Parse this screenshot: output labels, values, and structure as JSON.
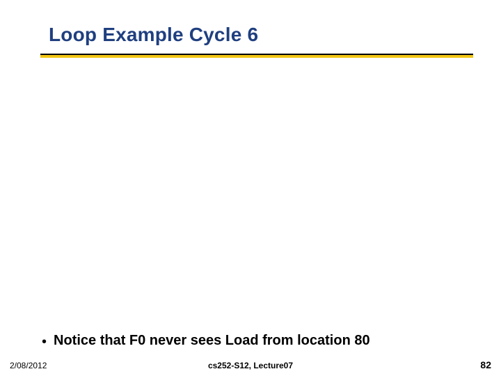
{
  "title": "Loop Example Cycle 6",
  "bullet": {
    "marker": "•",
    "text": "Notice that F0 never sees Load from location 80"
  },
  "footer": {
    "date": "2/08/2012",
    "center": "cs252-S12, Lecture07",
    "page": "82"
  }
}
